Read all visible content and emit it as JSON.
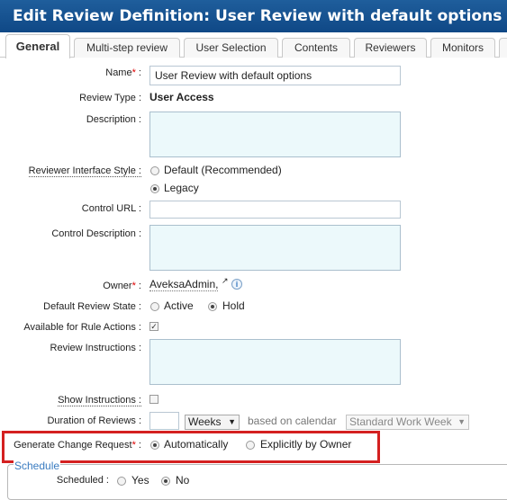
{
  "title": "Edit Review Definition: User Review with default options",
  "tabs": [
    "General",
    "Multi-step review",
    "User Selection",
    "Contents",
    "Reviewers",
    "Monitors"
  ],
  "form": {
    "name_label": "Name",
    "required_mark": "*",
    "name_value": "User Review with default options",
    "review_type_label": "Review Type :",
    "review_type_value": "User Access",
    "description_label": "Description :",
    "reviewer_interface_label": "Reviewer Interface Style :",
    "reviewer_interface_options": [
      "Default (Recommended)",
      "Legacy"
    ],
    "reviewer_interface_selected": "Legacy",
    "control_url_label": "Control URL :",
    "control_description_label": "Control Description :",
    "owner_label": "Owner",
    "owner_value": "AveksaAdmin,",
    "default_state_label": "Default Review State :",
    "default_state_options": [
      "Active",
      "Hold"
    ],
    "default_state_selected": "Hold",
    "rule_actions_label": "Available for Rule Actions :",
    "rule_actions_checked": true,
    "review_instructions_label": "Review Instructions :",
    "show_instructions_label": "Show Instructions :",
    "show_instructions_checked": false,
    "duration_label": "Duration of Reviews :",
    "duration_value": "",
    "duration_unit": "Weeks",
    "based_on_text": "based on calendar",
    "calendar_value": "Standard Work Week",
    "change_request_label": "Generate Change Request",
    "change_request_options": [
      "Automatically",
      "Explicitly by Owner"
    ],
    "change_request_selected": "Automatically"
  },
  "schedule": {
    "legend": "Schedule",
    "scheduled_label": "Scheduled :",
    "options": [
      "Yes",
      "No"
    ],
    "selected": "No"
  },
  "colors": {
    "title_bar": "#1f5e9c",
    "highlight_box": "#d42020",
    "legend_text": "#3a7cc1",
    "required": "#dd0000"
  }
}
